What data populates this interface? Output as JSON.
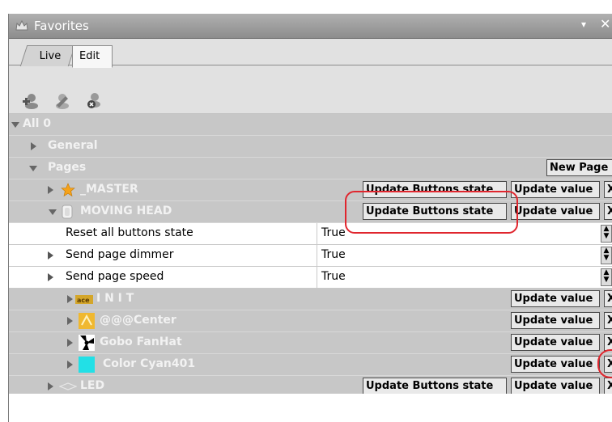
{
  "window": {
    "title": "Favorites",
    "chevron": "▾",
    "close": "✕"
  },
  "tabs": [
    "Live",
    "Edit"
  ],
  "toolbar": {
    "icons": [
      "add-favorite-icon",
      "edit-favorite-icon",
      "remove-favorite-icon"
    ]
  },
  "tree": {
    "all": "All 0",
    "general": "General",
    "pages": "Pages",
    "new_page": "New Page",
    "master": "_MASTER",
    "moving_head": "MOVING HEAD",
    "update_buttons_state": "Update Buttons state",
    "update_value": "Update value",
    "x": "X",
    "props": [
      {
        "name": "Reset all buttons state",
        "value": "True"
      },
      {
        "name": "Send page dimmer",
        "value": "True"
      },
      {
        "name": "Send page speed",
        "value": "True"
      }
    ],
    "children": [
      {
        "label": "I N I T",
        "icon": "init-icon"
      },
      {
        "label": "@@@Center",
        "icon": "center-icon"
      },
      {
        "label": "Gobo FanHat",
        "icon": "gobo-icon"
      },
      {
        "label": "Color Cyan401",
        "icon": "cyan-swatch-icon",
        "color": "#22e0e6"
      }
    ],
    "led": "LED"
  },
  "colors": {
    "row_bg": "#c7c7c7",
    "accent_red": "#e0262e",
    "cyan": "#22e0e6"
  }
}
